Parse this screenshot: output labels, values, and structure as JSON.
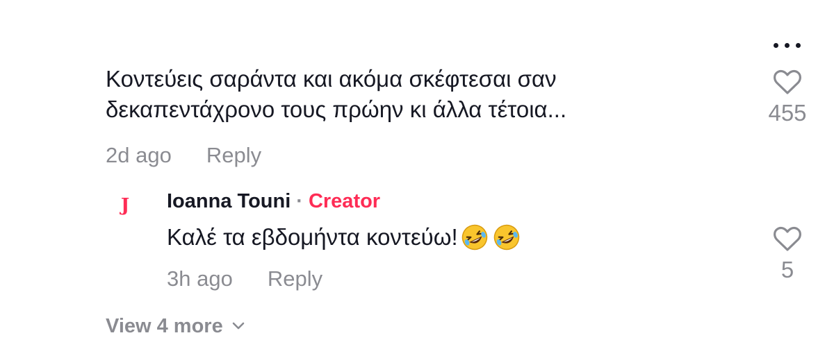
{
  "comment": {
    "text_line1": "Κοντεύεις σαράντα και ακόμα σκέφτεσαι σαν",
    "text_line2": "δεκαπεντάχρονο τους πρώην κι άλλα τέτοια...",
    "timestamp": "2d ago",
    "reply_label": "Reply",
    "like_count": "455",
    "more_icon": "ellipsis-icon",
    "like_icon": "heart-outline-icon"
  },
  "reply": {
    "avatar_letter": "J",
    "author": "Ioanna Touni",
    "separator": "·",
    "badge": "Creator",
    "text": "Καλέ τα εβδομήντα κοντεύω!",
    "emojis": [
      "rolling-on-floor-laughing-emoji",
      "rolling-on-floor-laughing-emoji"
    ],
    "timestamp": "3h ago",
    "reply_label": "Reply",
    "like_count": "5",
    "like_icon": "heart-outline-icon"
  },
  "view_more": {
    "label": "View 4 more",
    "icon": "chevron-down-icon"
  },
  "colors": {
    "text_primary": "#161823",
    "text_secondary": "rgba(22,24,35,0.5)",
    "creator_accent": "#fe2c55"
  }
}
